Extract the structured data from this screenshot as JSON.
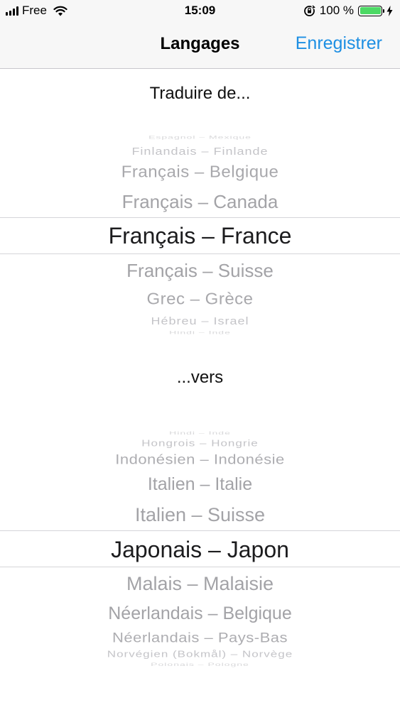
{
  "status_bar": {
    "carrier": "Free",
    "time": "15:09",
    "battery_text": "100 %",
    "battery_level": 1.0,
    "battery_color": "#4cd964",
    "icons": [
      "signal-icon",
      "wifi-icon",
      "orientation-lock-icon",
      "battery-icon",
      "charging-bolt-icon"
    ]
  },
  "nav": {
    "title": "Langages",
    "save_label": "Enregistrer",
    "accent_color": "#1d8fe3"
  },
  "from_section": {
    "label": "Traduire de...",
    "items": [
      "Espagnol – Mexique",
      "Finlandais – Finlande",
      "Français – Belgique",
      "Français – Canada",
      "Français – France",
      "Français – Suisse",
      "Grec – Grèce",
      "Hébreu – Israel",
      "Hindi – Inde"
    ],
    "selected": "Français – France"
  },
  "to_section": {
    "label": "...vers",
    "items": [
      "Hindi – Inde",
      "Hongrois – Hongrie",
      "Indonésien – Indonésie",
      "Italien – Italie",
      "Italien – Suisse",
      "Japonais – Japon",
      "Malais – Malaisie",
      "Néerlandais – Belgique",
      "Néerlandais – Pays-Bas",
      "Norvégien (Bokmål) – Norvège",
      "Polonais – Pologne"
    ],
    "selected": "Japonais – Japon"
  }
}
